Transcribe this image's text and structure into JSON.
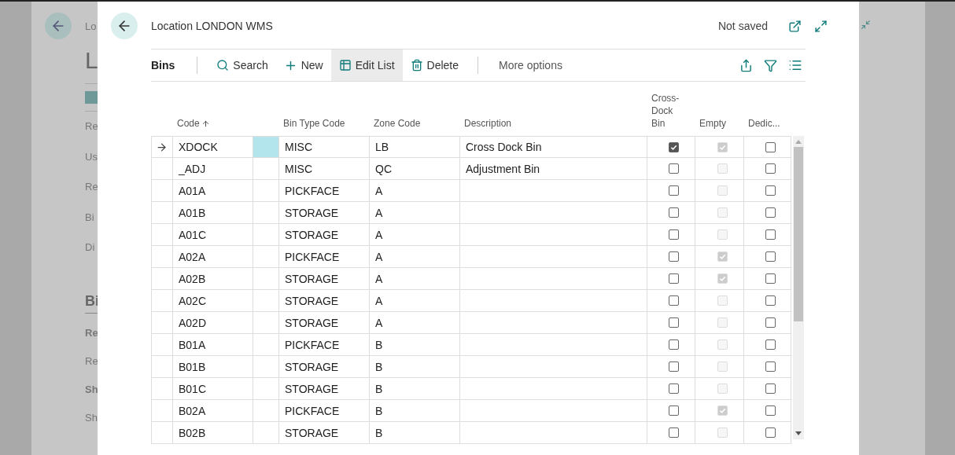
{
  "background_page": {
    "breadcrumb": "Lo",
    "title": "L",
    "fields": [
      "Re",
      "Us",
      "Re",
      "Bi",
      "Di"
    ],
    "section": "Bi",
    "section_items": [
      {
        "text": "Re",
        "bold": true
      },
      {
        "text": "Re",
        "bold": false
      },
      {
        "text": "Sh",
        "bold": true
      },
      {
        "text": "Sh",
        "bold": false
      }
    ]
  },
  "dialog": {
    "title": "Location LONDON WMS",
    "status": "Not saved"
  },
  "action_bar": {
    "title": "Bins",
    "actions": [
      {
        "label": "Search",
        "kind": "search",
        "selected": false
      },
      {
        "label": "New",
        "kind": "new",
        "selected": false
      },
      {
        "label": "Edit List",
        "kind": "edit",
        "selected": true
      },
      {
        "label": "Delete",
        "kind": "delete",
        "selected": false
      }
    ],
    "more": "More options"
  },
  "table": {
    "columns": [
      {
        "label": "Code",
        "sorted": true
      },
      {
        "label": "Bin Type Code",
        "sorted": false
      },
      {
        "label": "Zone Code",
        "sorted": false
      },
      {
        "label": "Description",
        "sorted": false
      },
      {
        "label": "Cross-Dock Bin",
        "sorted": false,
        "disabled": false
      },
      {
        "label": "Empty",
        "sorted": false,
        "disabled": true
      },
      {
        "label": "Dedic...",
        "sorted": false,
        "disabled": false
      }
    ],
    "rows": [
      {
        "code": "XDOCK",
        "bin_type": "MISC",
        "zone": "LB",
        "description": "Cross Dock Bin",
        "cross_dock": true,
        "empty": true,
        "dedicated": false,
        "selected": true
      },
      {
        "code": "_ADJ",
        "bin_type": "MISC",
        "zone": "QC",
        "description": "Adjustment Bin",
        "cross_dock": false,
        "empty": false,
        "dedicated": false,
        "selected": false
      },
      {
        "code": "A01A",
        "bin_type": "PICKFACE",
        "zone": "A",
        "cross_dock": false,
        "empty": false,
        "dedicated": false,
        "selected": false
      },
      {
        "code": "A01B",
        "bin_type": "STORAGE",
        "zone": "A",
        "cross_dock": false,
        "empty": false,
        "dedicated": false,
        "selected": false
      },
      {
        "code": "A01C",
        "bin_type": "STORAGE",
        "zone": "A",
        "cross_dock": false,
        "empty": false,
        "dedicated": false,
        "selected": false
      },
      {
        "code": "A02A",
        "bin_type": "PICKFACE",
        "zone": "A",
        "cross_dock": false,
        "empty": true,
        "dedicated": false,
        "selected": false
      },
      {
        "code": "A02B",
        "bin_type": "STORAGE",
        "zone": "A",
        "cross_dock": false,
        "empty": true,
        "dedicated": false,
        "selected": false
      },
      {
        "code": "A02C",
        "bin_type": "STORAGE",
        "zone": "A",
        "cross_dock": false,
        "empty": false,
        "dedicated": false,
        "selected": false
      },
      {
        "code": "A02D",
        "bin_type": "STORAGE",
        "zone": "A",
        "cross_dock": false,
        "empty": false,
        "dedicated": false,
        "selected": false
      },
      {
        "code": "B01A",
        "bin_type": "PICKFACE",
        "zone": "B",
        "cross_dock": false,
        "empty": false,
        "dedicated": false,
        "selected": false
      },
      {
        "code": "B01B",
        "bin_type": "STORAGE",
        "zone": "B",
        "cross_dock": false,
        "empty": false,
        "dedicated": false,
        "selected": false
      },
      {
        "code": "B01C",
        "bin_type": "STORAGE",
        "zone": "B",
        "cross_dock": false,
        "empty": false,
        "dedicated": false,
        "selected": false
      },
      {
        "code": "B02A",
        "bin_type": "PICKFACE",
        "zone": "B",
        "cross_dock": false,
        "empty": true,
        "dedicated": false,
        "selected": false
      },
      {
        "code": "B02B",
        "bin_type": "STORAGE",
        "zone": "B",
        "cross_dock": false,
        "empty": false,
        "dedicated": false,
        "selected": false
      }
    ]
  }
}
